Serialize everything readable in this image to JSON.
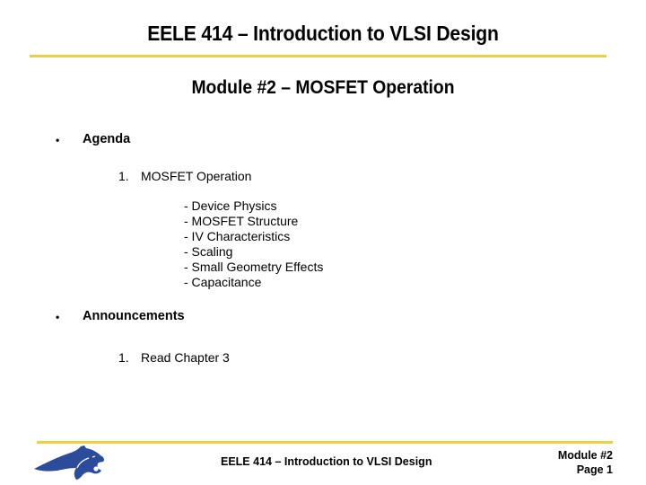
{
  "header": {
    "title": "EELE 414 – Introduction to VLSI Design",
    "subtitle": "Module #2 – MOSFET Operation"
  },
  "content": {
    "sections": [
      {
        "bullet": "•",
        "heading": "Agenda",
        "items": [
          {
            "number": "1.",
            "label": "MOSFET Operation",
            "subitems": [
              "- Device Physics",
              "- MOSFET Structure",
              "- IV Characteristics",
              "- Scaling",
              "- Small Geometry Effects",
              "- Capacitance"
            ]
          }
        ]
      },
      {
        "bullet": "•",
        "heading": "Announcements",
        "items": [
          {
            "number": "1.",
            "label": "Read Chapter 3"
          }
        ]
      }
    ]
  },
  "footer": {
    "course_title": "EELE 414 – Introduction to VLSI Design",
    "module": "Module #2",
    "page": "Page 1",
    "logo_icon": "bobcat-logo-icon"
  },
  "colors": {
    "accent_rule": "#f0cf3c",
    "logo_blue": "#2b4c9b"
  }
}
